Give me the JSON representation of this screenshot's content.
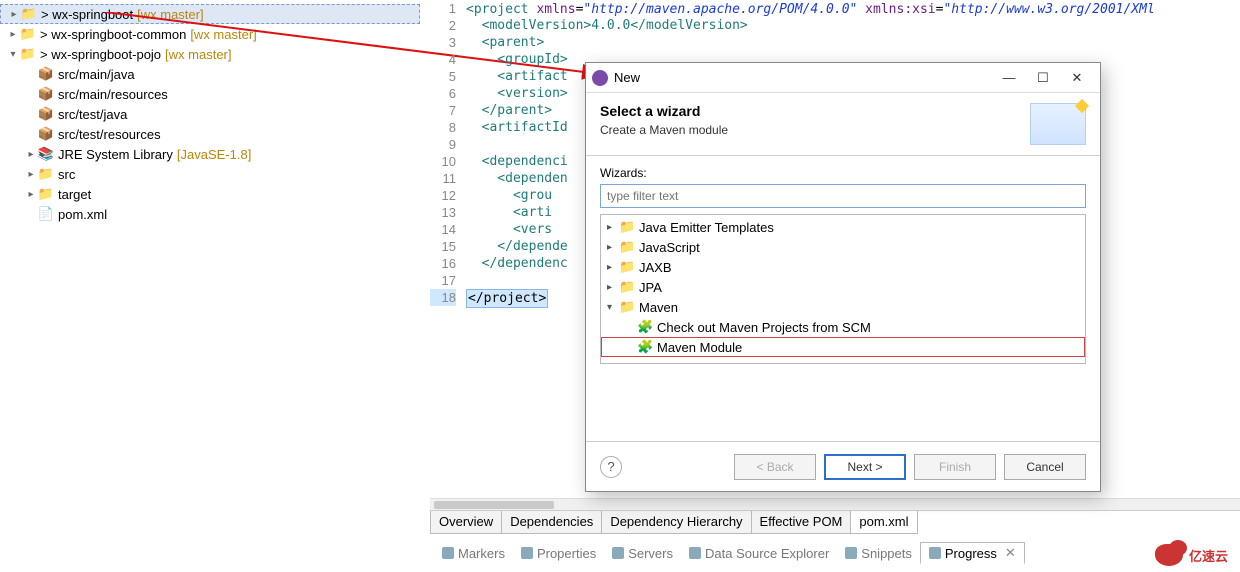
{
  "tree": {
    "items": [
      {
        "label": "> wx-springboot",
        "deco": "[wx master]",
        "indent": 0,
        "arrow": "closed",
        "sel": true,
        "type": "proj"
      },
      {
        "label": "> wx-springboot-common",
        "deco": "[wx master]",
        "indent": 0,
        "arrow": "closed",
        "type": "proj"
      },
      {
        "label": "> wx-springboot-pojo",
        "deco": "[wx master]",
        "indent": 0,
        "arrow": "open",
        "type": "proj"
      },
      {
        "label": "src/main/java",
        "indent": 1,
        "type": "pkg"
      },
      {
        "label": "src/main/resources",
        "indent": 1,
        "type": "pkg"
      },
      {
        "label": "src/test/java",
        "indent": 1,
        "type": "pkg"
      },
      {
        "label": "src/test/resources",
        "indent": 1,
        "type": "pkg"
      },
      {
        "label": "JRE System Library",
        "deco": "[JavaSE-1.8]",
        "indent": 1,
        "arrow": "closed",
        "type": "lib"
      },
      {
        "label": "src",
        "indent": 1,
        "arrow": "closed",
        "type": "folder"
      },
      {
        "label": "target",
        "indent": 1,
        "arrow": "closed",
        "type": "folder"
      },
      {
        "label": "pom.xml",
        "indent": 1,
        "type": "file"
      }
    ]
  },
  "code": {
    "lines": [
      "1",
      "2",
      "3",
      "4",
      "5",
      "6",
      "7",
      "8",
      "9",
      "10",
      "11",
      "12",
      "13",
      "14",
      "15",
      "16",
      "17",
      "18"
    ],
    "src": {
      "l1a": "<project ",
      "l1b": "xmlns",
      "l1c": "=",
      "l1d": "\"http://maven.apache.org/POM/4.0.0\"",
      "l1e": " xmlns:xsi",
      "l1f": "=",
      "l1g": "\"http://www.w3.org/2001/XMl",
      "l2": "  <modelVersion>4.0.0</modelVersion>",
      "l3": "  <parent>",
      "l4": "    <groupId>",
      "l5": "    <artifact",
      "l6": "    <version>",
      "l7": "  </parent>",
      "l8": "  <artifactId",
      "l9": "",
      "l10": "  <dependenci",
      "l11": "    <dependen",
      "l12": "      <grou",
      "l13": "      <arti",
      "l14": "      <vers",
      "l15": "    </depende",
      "l16": "  </dependenc",
      "l17": "",
      "l18": "</project>"
    }
  },
  "pomtabs": [
    "Overview",
    "Dependencies",
    "Dependency Hierarchy",
    "Effective POM",
    "pom.xml"
  ],
  "views": {
    "items": [
      "Markers",
      "Properties",
      "Servers",
      "Data Source Explorer",
      "Snippets",
      "Progress"
    ],
    "active": "Progress",
    "close_glyph": "✕"
  },
  "dialog": {
    "title": "New",
    "banner_title": "Select a wizard",
    "banner_sub": "Create a Maven module",
    "wizards_label": "Wizards:",
    "filter_placeholder": "type filter text",
    "tree": [
      {
        "label": "Java Emitter Templates",
        "kind": "fold",
        "arrow": "closed"
      },
      {
        "label": "JavaScript",
        "kind": "fold",
        "arrow": "closed"
      },
      {
        "label": "JAXB",
        "kind": "fold",
        "arrow": "closed"
      },
      {
        "label": "JPA",
        "kind": "fold",
        "arrow": "closed"
      },
      {
        "label": "Maven",
        "kind": "fold",
        "arrow": "open"
      },
      {
        "label": "Check out Maven Projects from SCM",
        "kind": "leaf"
      },
      {
        "label": "Maven Module",
        "kind": "leaf",
        "sel": true
      }
    ],
    "buttons": {
      "back": "< Back",
      "next": "Next >",
      "finish": "Finish",
      "cancel": "Cancel",
      "help": "?"
    },
    "win": {
      "min": "—",
      "max": "☐",
      "close": "✕"
    }
  },
  "logo": "亿速云"
}
